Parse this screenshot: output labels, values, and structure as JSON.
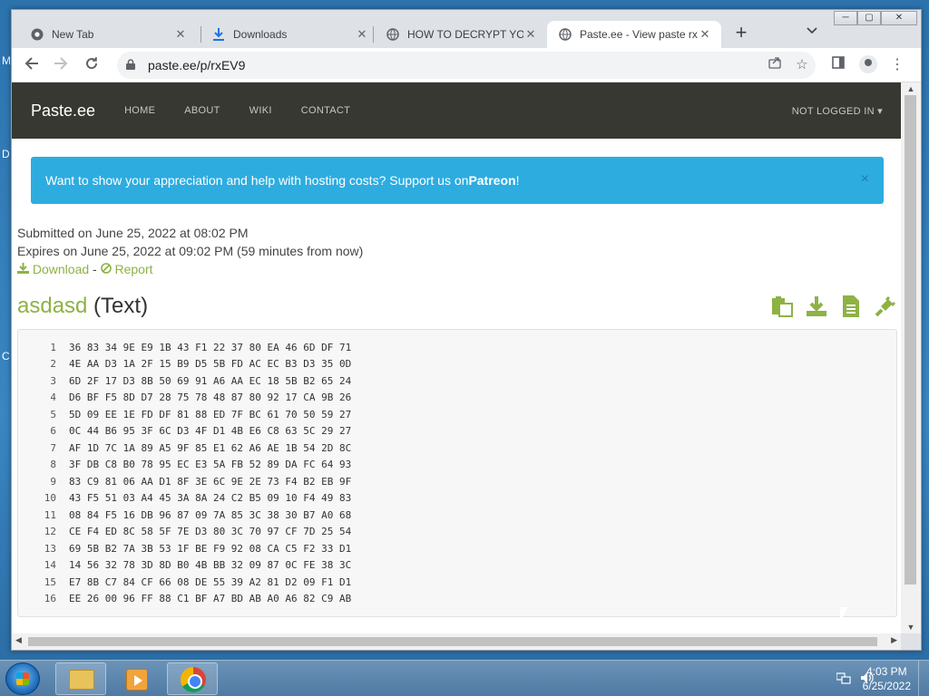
{
  "browser": {
    "tabs": [
      {
        "label": "New Tab",
        "close": "✕"
      },
      {
        "label": "Downloads",
        "close": "✕"
      },
      {
        "label": "HOW TO DECRYPT YOU",
        "close": "✕"
      },
      {
        "label": "Paste.ee - View paste rx",
        "close": "✕"
      }
    ],
    "new_tab": "+",
    "address": "paste.ee/p/rxEV9"
  },
  "site": {
    "brand": "Paste.ee",
    "nav": [
      "HOME",
      "ABOUT",
      "WIKI",
      "CONTACT"
    ],
    "login": "NOT LOGGED IN ▾"
  },
  "alert": {
    "text": "Want to show your appreciation and help with hosting costs? Support us on ",
    "link": "Patreon",
    "suffix": "!",
    "close": "×"
  },
  "meta": {
    "submitted": "Submitted on June 25, 2022 at 08:02 PM",
    "expires": "Expires on June 25, 2022 at 09:02 PM (59 minutes from now)",
    "download": "Download",
    "separator": " - ",
    "report": "Report"
  },
  "paste": {
    "name": "asdasd",
    "type": " (Text)",
    "lines": [
      "36 83 34 9E E9 1B 43 F1 22 37 80 EA 46 6D DF 71",
      "4E AA D3 1A 2F 15 B9 D5 5B FD AC EC B3 D3 35 0D",
      "6D 2F 17 D3 8B 50 69 91 A6 AA EC 18 5B B2 65 24",
      "D6 BF F5 8D D7 28 75 78 48 87 80 92 17 CA 9B 26",
      "5D 09 EE 1E FD DF 81 88 ED 7F BC 61 70 50 59 27",
      "0C 44 B6 95 3F 6C D3 4F D1 4B E6 C8 63 5C 29 27",
      "AF 1D 7C 1A 89 A5 9F 85 E1 62 A6 AE 1B 54 2D 8C",
      "3F DB C8 B0 78 95 EC E3 5A FB 52 89 DA FC 64 93",
      "83 C9 81 06 AA D1 8F 3E 6C 9E 2E 73 F4 B2 EB 9F",
      "43 F5 51 03 A4 45 3A 8A 24 C2 B5 09 10 F4 49 83",
      "08 84 F5 16 DB 96 87 09 7A 85 3C 38 30 B7 A0 68",
      "CE F4 ED 8C 58 5F 7E D3 80 3C 70 97 CF 7D 25 54",
      "69 5B B2 7A 3B 53 1F BE F9 92 08 CA C5 F2 33 D1",
      "14 56 32 78 3D 8D B0 4B BB 32 09 87 0C FE 38 3C",
      "E7 8B C7 84 CF 66 08 DE 55 39 A2 81 D2 09 F1 D1",
      "EE 26 00 96 FF 88 C1 BF A7 BD AB A0 A6 82 C9 AB"
    ]
  },
  "taskbar": {
    "time": "4:03 PM",
    "date": "6/25/2022"
  },
  "desktop": {
    "letters": [
      "M",
      "D",
      "C"
    ]
  }
}
